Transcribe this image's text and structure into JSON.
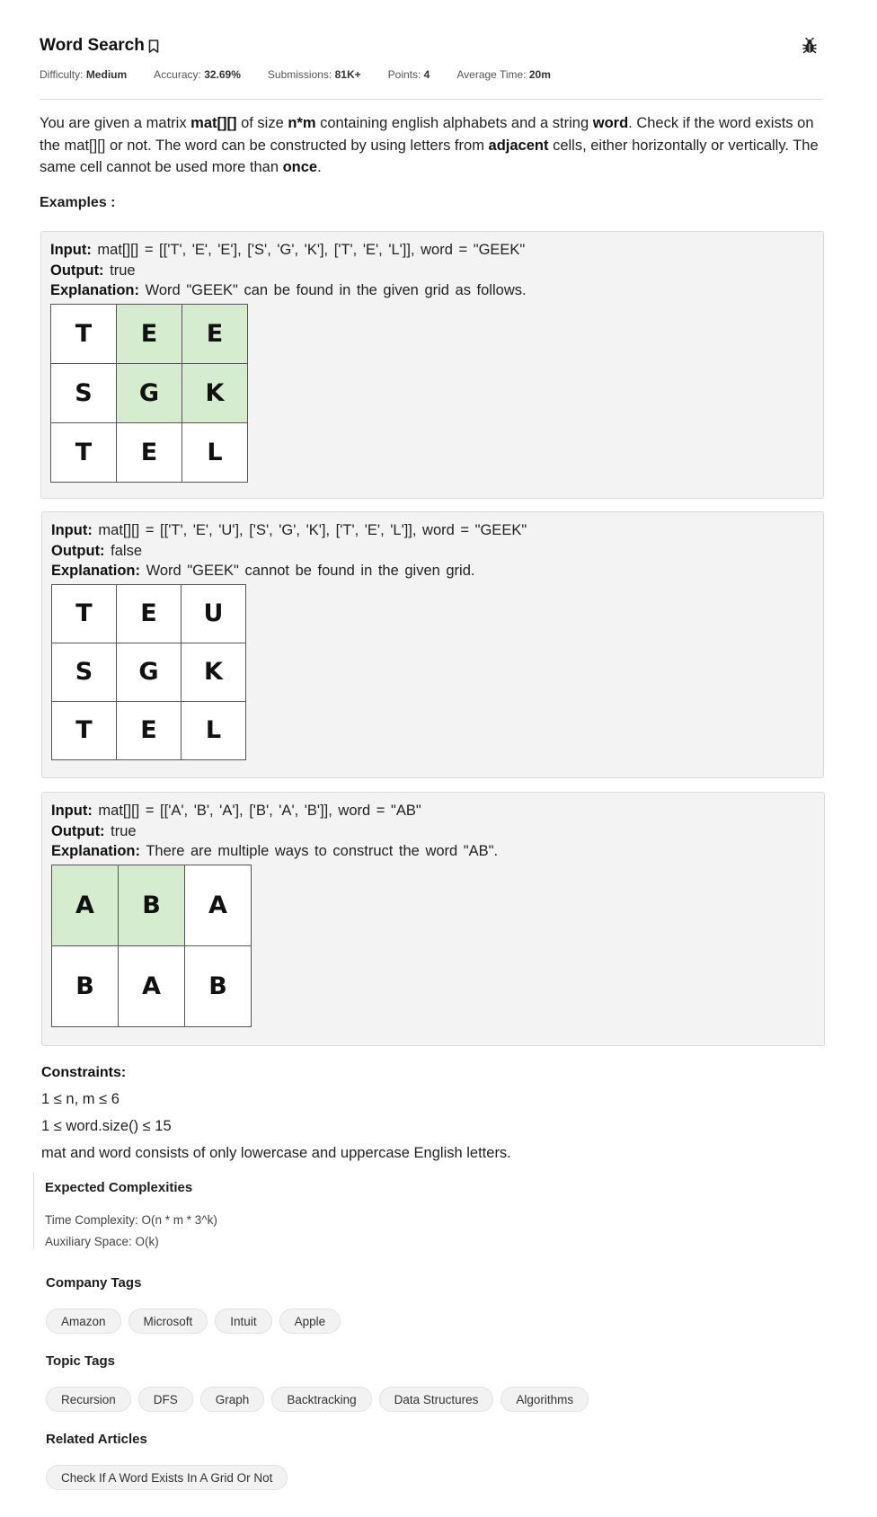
{
  "header": {
    "title": "Word Search",
    "meta": [
      {
        "label": "Difficulty:",
        "value": "Medium"
      },
      {
        "label": "Accuracy:",
        "value": "32.69%"
      },
      {
        "label": "Submissions:",
        "value": "81K+"
      },
      {
        "label": "Points:",
        "value": "4"
      },
      {
        "label": "Average Time:",
        "value": "20m"
      }
    ]
  },
  "statement": {
    "parts": [
      {
        "text": "You are given a matrix ",
        "bold": false
      },
      {
        "text": "mat[][]",
        "bold": true
      },
      {
        "text": " of size ",
        "bold": false
      },
      {
        "text": "n*m",
        "bold": true
      },
      {
        "text": " containing english alphabets and a string ",
        "bold": false
      },
      {
        "text": "word",
        "bold": true
      },
      {
        "text": ". Check if the word exists on the mat[][] or not. The word can be constructed by using letters from ",
        "bold": false
      },
      {
        "text": "adjacent",
        "bold": true
      },
      {
        "text": " cells, either horizontally or vertically. The same cell cannot be used more than ",
        "bold": false
      },
      {
        "text": "once",
        "bold": true
      },
      {
        "text": ".",
        "bold": false
      }
    ]
  },
  "examples_label": "Examples :",
  "examples": [
    {
      "input_label": "Input:",
      "input": "mat[][] = [['T', 'E', 'E'], ['S', 'G', 'K'], ['T', 'E', 'L']], word = \"GEEK\"",
      "output_label": "Output:",
      "output": "true",
      "explanation_label": "Explanation:",
      "explanation": "Word \"GEEK\" can be found in the given grid as follows.",
      "grid": [
        [
          "T",
          "E",
          "E"
        ],
        [
          "S",
          "G",
          "K"
        ],
        [
          "T",
          "E",
          "L"
        ]
      ],
      "highlight": [
        [
          false,
          true,
          true
        ],
        [
          false,
          true,
          true
        ],
        [
          false,
          false,
          false
        ]
      ]
    },
    {
      "input_label": "Input:",
      "input": "mat[][] = [['T', 'E', 'U'], ['S', 'G', 'K'], ['T', 'E', 'L']], word = \"GEEK\"",
      "output_label": "Output:",
      "output": "false",
      "explanation_label": "Explanation:",
      "explanation": "Word \"GEEK\" cannot be found in the given grid.",
      "grid": [
        [
          "T",
          "E",
          "U"
        ],
        [
          "S",
          "G",
          "K"
        ],
        [
          "T",
          "E",
          "L"
        ]
      ],
      "highlight": [
        [
          false,
          false,
          false
        ],
        [
          false,
          false,
          false
        ],
        [
          false,
          false,
          false
        ]
      ]
    },
    {
      "input_label": "Input:",
      "input": "mat[][] = [['A', 'B', 'A'], ['B', 'A', 'B']], word = \"AB\"",
      "output_label": "Output:",
      "output": "true",
      "explanation_label": "Explanation:",
      "explanation": "There are multiple ways to construct the word \"AB\".",
      "grid": [
        [
          "A",
          "B",
          "A"
        ],
        [
          "B",
          "A",
          "B"
        ]
      ],
      "highlight": [
        [
          true,
          true,
          false
        ],
        [
          false,
          false,
          false
        ]
      ]
    }
  ],
  "constraints": {
    "heading": "Constraints:",
    "lines": [
      "1 ≤ n, m ≤ 6",
      "1 ≤ word.size() ≤ 15",
      "mat and word consists of only lowercase and uppercase English letters."
    ]
  },
  "complexities": {
    "heading": "Expected Complexities",
    "time": "Time Complexity: O(n * m * 3^k)",
    "space": "Auxiliary Space: O(k)"
  },
  "company_tags": {
    "heading": "Company Tags",
    "tags": [
      "Amazon",
      "Microsoft",
      "Intuit",
      "Apple"
    ]
  },
  "topic_tags": {
    "heading": "Topic Tags",
    "tags": [
      "Recursion",
      "DFS",
      "Graph",
      "Backtracking",
      "Data Structures",
      "Algorithms"
    ]
  },
  "related_articles": {
    "heading": "Related Articles",
    "items": [
      "Check If A Word Exists In A Grid Or Not"
    ]
  },
  "colors": {
    "highlight_cell": "#d6ecce",
    "example_bg": "#f3f3f3"
  },
  "icons": {
    "bookmark": "bookmark-icon",
    "bug": "bug-icon"
  }
}
